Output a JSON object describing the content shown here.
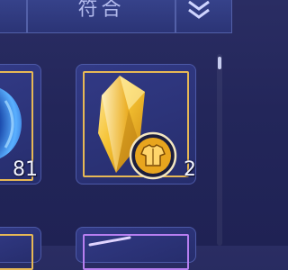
{
  "tabs": {
    "left": "",
    "middle": "符合",
    "right_icon": "double-chevron-down-icon"
  },
  "inventory": {
    "items": [
      {
        "icon": "orb-icon",
        "frame": "gold",
        "count": "81"
      },
      {
        "icon": "crystal-icon",
        "badge": "shirt-badge-icon",
        "frame": "gold",
        "count": "2"
      },
      {
        "icon": "",
        "frame": "gold",
        "count": ""
      },
      {
        "icon": "arrow-icon",
        "frame": "purple",
        "count": ""
      }
    ]
  },
  "colors": {
    "gold_frame": "#e7b855",
    "purple_frame": "#b77ef0",
    "background": "#23265a"
  }
}
